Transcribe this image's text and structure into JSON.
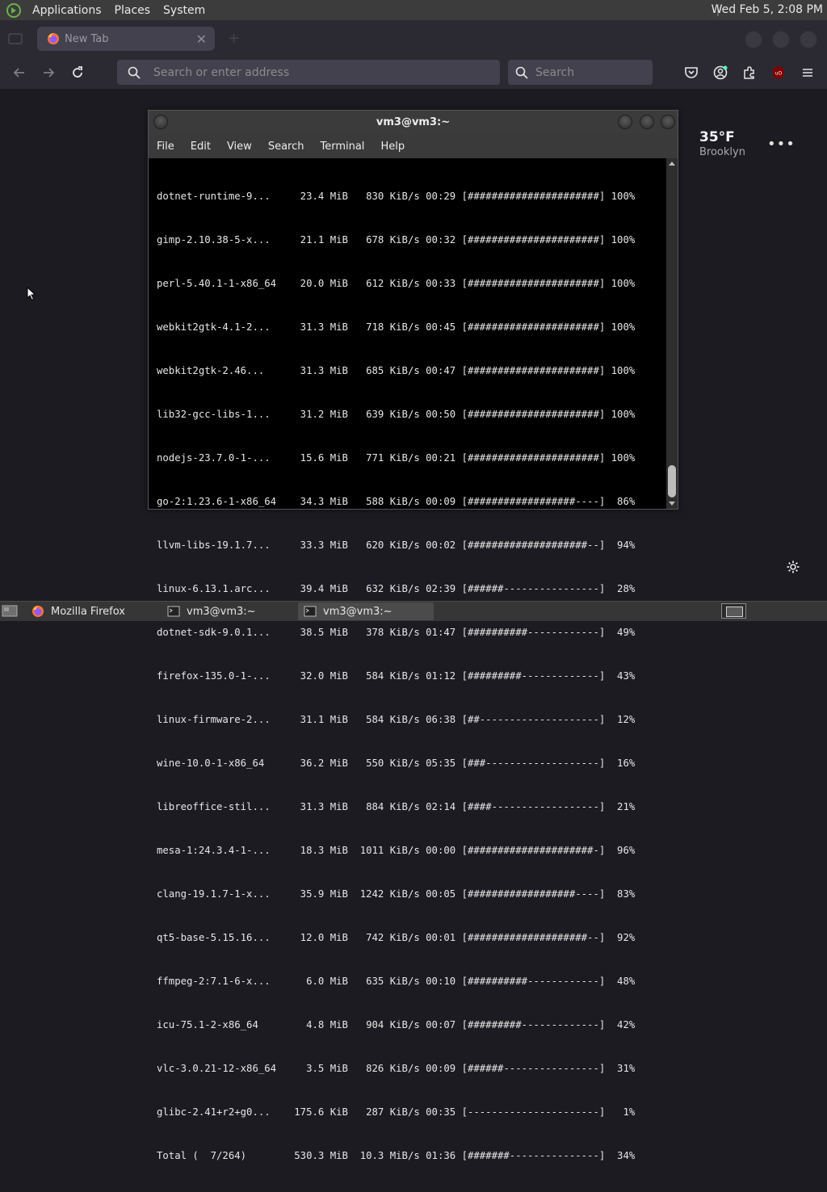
{
  "top_panel": {
    "menus": [
      "Applications",
      "Places",
      "System"
    ],
    "clock": "Wed Feb  5, 2:08 PM"
  },
  "browser": {
    "tab_title": "New Tab",
    "url_placeholder": "Search or enter address",
    "search_placeholder": "Search",
    "accent_color": "#2b2a33"
  },
  "weather": {
    "temperature": "35°F",
    "city": "Brooklyn"
  },
  "terminal": {
    "title": "vm3@vm3:~",
    "menus": [
      "File",
      "Edit",
      "View",
      "Search",
      "Terminal",
      "Help"
    ],
    "lines": [
      "dotnet-runtime-9...     23.4 MiB   830 KiB/s 00:29 [######################] 100%",
      "gimp-2.10.38-5-x...     21.1 MiB   678 KiB/s 00:32 [######################] 100%",
      "perl-5.40.1-1-x86_64    20.0 MiB   612 KiB/s 00:33 [######################] 100%",
      "webkit2gtk-4.1-2...     31.3 MiB   718 KiB/s 00:45 [######################] 100%",
      "webkit2gtk-2.46...      31.3 MiB   685 KiB/s 00:47 [######################] 100%",
      "lib32-gcc-libs-1...     31.2 MiB   639 KiB/s 00:50 [######################] 100%",
      "nodejs-23.7.0-1-...     15.6 MiB   771 KiB/s 00:21 [######################] 100%",
      "go-2:1.23.6-1-x86_64    34.3 MiB   588 KiB/s 00:09 [##################----]  86%",
      "llvm-libs-19.1.7...     33.3 MiB   620 KiB/s 00:02 [####################--]  94%",
      "linux-6.13.1.arc...     39.4 MiB   632 KiB/s 02:39 [######----------------]  28%",
      "dotnet-sdk-9.0.1...     38.5 MiB   378 KiB/s 01:47 [##########------------]  49%",
      "firefox-135.0-1-...     32.0 MiB   584 KiB/s 01:12 [#########-------------]  43%",
      "linux-firmware-2...     31.1 MiB   584 KiB/s 06:38 [##--------------------]  12%",
      "wine-10.0-1-x86_64      36.2 MiB   550 KiB/s 05:35 [###-------------------]  16%",
      "libreoffice-stil...     31.3 MiB   884 KiB/s 02:14 [####------------------]  21%",
      "mesa-1:24.3.4-1-...     18.3 MiB  1011 KiB/s 00:00 [#####################-]  96%",
      "clang-19.1.7-1-x...     35.9 MiB  1242 KiB/s 00:05 [##################----]  83%",
      "qt5-base-5.15.16...     12.0 MiB   742 KiB/s 00:01 [####################--]  92%",
      "ffmpeg-2:7.1-6-x...      6.0 MiB   635 KiB/s 00:10 [##########------------]  48%",
      "icu-75.1-2-x86_64        4.8 MiB   904 KiB/s 00:07 [#########-------------]  42%",
      "vlc-3.0.21-12-x86_64     3.5 MiB   826 KiB/s 00:09 [######----------------]  31%",
      "glibc-2.41+r2+g0...    175.6 KiB   287 KiB/s 00:35 [----------------------]   1%",
      "Total (  7/264)        530.3 MiB  10.3 MiB/s 01:36 [#######---------------]  34%"
    ]
  },
  "taskbar": {
    "tasks": [
      "Mozilla Firefox",
      "vm3@vm3:~",
      "vm3@vm3:~"
    ]
  }
}
